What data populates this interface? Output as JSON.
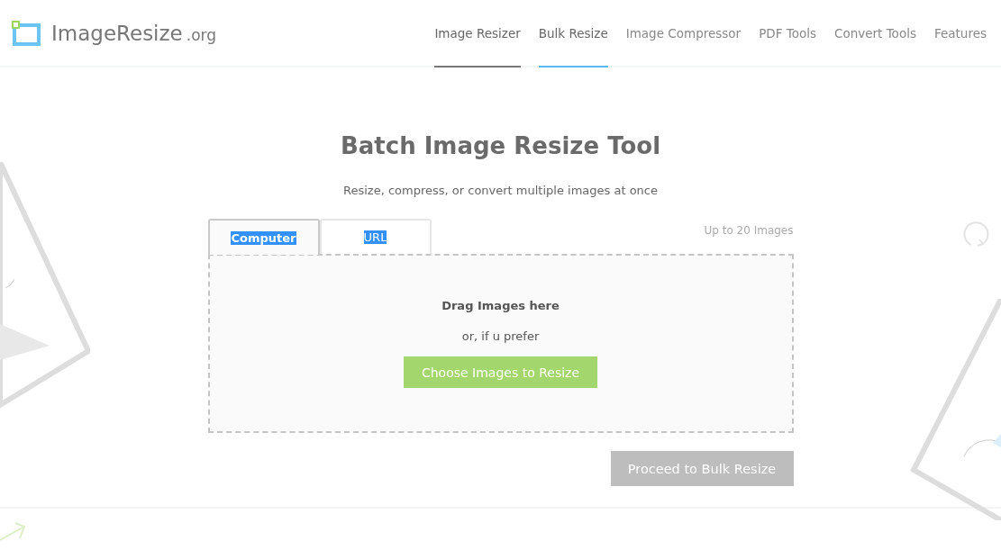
{
  "header": {
    "logo": {
      "name": "ImageResize",
      "suffix": ".org"
    },
    "nav": [
      {
        "label": "Image Resizer",
        "selected": false,
        "hovered": true
      },
      {
        "label": "Bulk Resize",
        "selected": true,
        "hovered": false
      },
      {
        "label": "Image Compressor",
        "selected": false,
        "hovered": false
      },
      {
        "label": "PDF Tools",
        "selected": false,
        "hovered": false
      },
      {
        "label": "Convert Tools",
        "selected": false,
        "hovered": false
      },
      {
        "label": "Features",
        "selected": false,
        "hovered": false
      }
    ]
  },
  "main": {
    "title": "Batch Image Resize Tool",
    "subtitle": "Resize, compress, or convert multiple images at once",
    "tabs": [
      {
        "label": "Computer",
        "selected": true,
        "text_highlighted": true
      },
      {
        "label": "URL",
        "selected": false,
        "text_highlighted": true
      }
    ],
    "limit": "Up to 20 Images",
    "dropzone": {
      "heading": "Drag Images here",
      "alt": "or, if u prefer",
      "button": "Choose Images to Resize"
    },
    "proceed": {
      "label": "Proceed to Bulk Resize",
      "disabled": true
    }
  }
}
